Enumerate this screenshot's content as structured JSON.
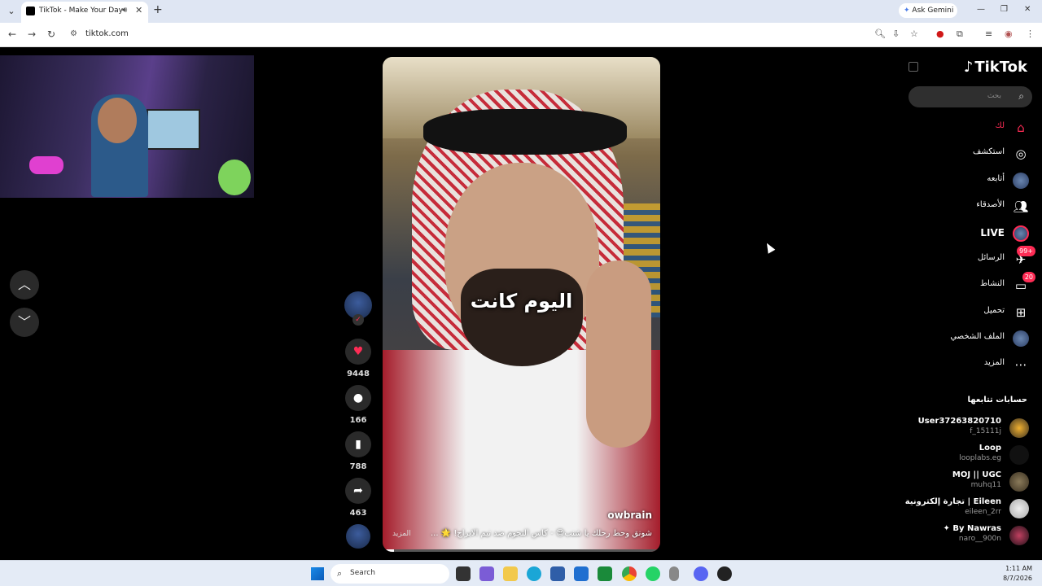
{
  "browser": {
    "tab_title": "TikTok - Make Your Day",
    "new_tab": "+",
    "ask_gemini": "Ask Gemini",
    "url": "tiktok.com"
  },
  "video": {
    "caption": "اليوم كانت",
    "author": "owbrain",
    "description": "شونق وحط رحلك يا شنب😍 - كاس النجوم ضد تيم الابراج! 🌟 ...",
    "more": "المزيد",
    "progress": 0.04
  },
  "actions": {
    "likes": "9448",
    "comments": "166",
    "saves": "788",
    "shares": "463"
  },
  "sidebar": {
    "logo": "TikTok",
    "search_placeholder": "بحث",
    "nav": [
      {
        "label": "لك"
      },
      {
        "label": "استكشف"
      },
      {
        "label": "أتابعه"
      },
      {
        "label": "الأصدقاء"
      },
      {
        "label": "LIVE"
      },
      {
        "label": "الرسائل",
        "badge": "99+"
      },
      {
        "label": "النشاط",
        "badge": "20"
      },
      {
        "label": "تحميل"
      },
      {
        "label": "الملف الشخصي"
      },
      {
        "label": "المزيد"
      }
    ],
    "following_title": "حسابات تتابعها",
    "accounts": [
      {
        "name": "User37263820710",
        "handle": "f_15111j"
      },
      {
        "name": "Loop",
        "handle": "looplabs.eg"
      },
      {
        "name": "MOJ || UGC",
        "handle": "muhq11"
      },
      {
        "name": "Eileen | تجارة إلكترونية",
        "handle": "eileen_2rr"
      },
      {
        "name": "By Nawras ✦",
        "handle": "naro__900n"
      }
    ]
  },
  "taskbar": {
    "search_label": "Search",
    "time": "1:11 AM",
    "date": "8/7/2026"
  }
}
